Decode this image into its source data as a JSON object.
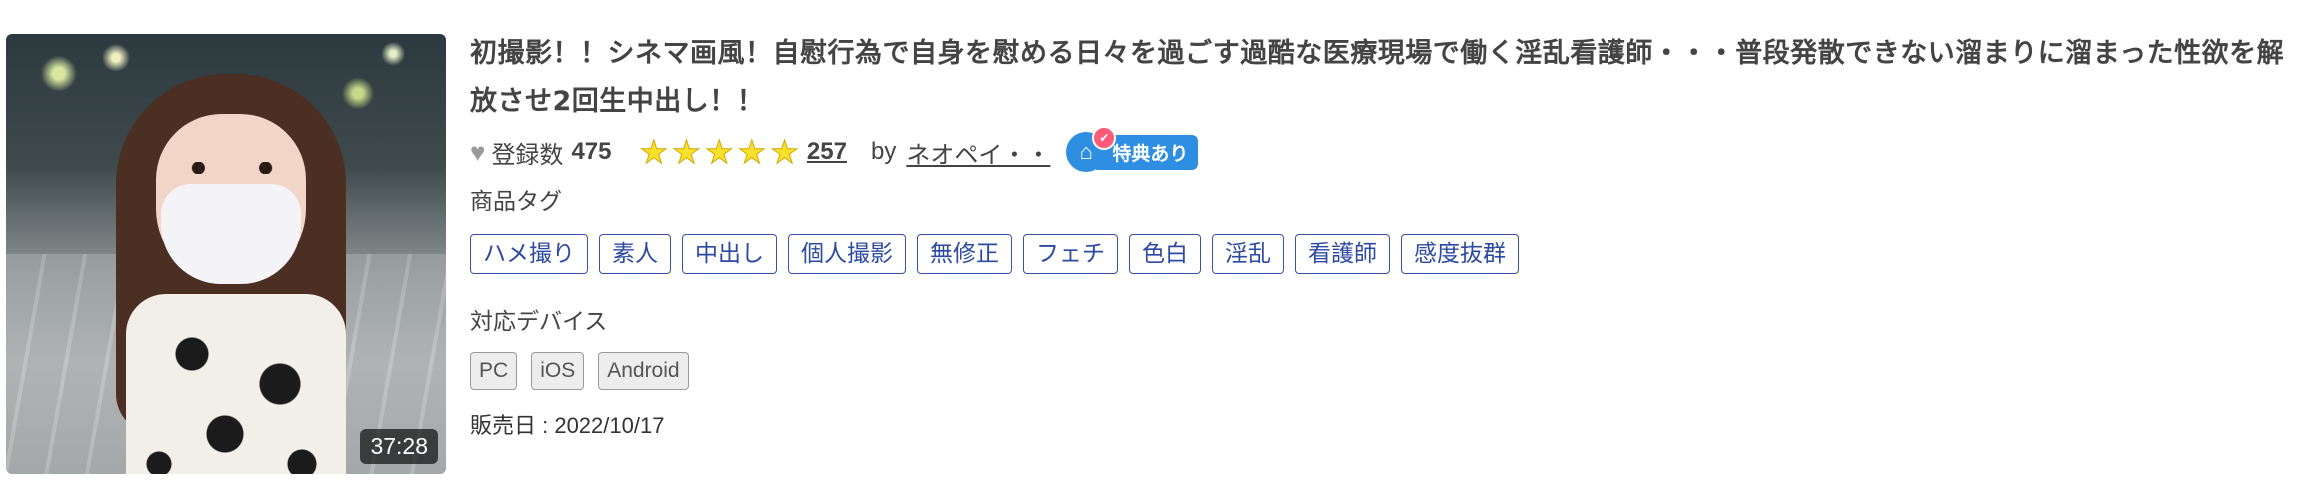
{
  "thumbnail": {
    "duration": "37:28"
  },
  "title": "初撮影！！シネマ画風！自慰行為で自身を慰める日々を過ごす過酷な医療現場で働く淫乱看護師・・・普段発散できない溜まりに溜まった性欲を解放させ2回生中出し！！",
  "meta": {
    "heart_icon": "heart-icon",
    "registered_label": "登録数",
    "registered_count": "475",
    "rating_stars": 5,
    "review_count": "257",
    "by_label": "by",
    "author": "ネオペイ・・",
    "perk_label": "特典あり"
  },
  "tags_title": "商品タグ",
  "tags": [
    "ハメ撮り",
    "素人",
    "中出し",
    "個人撮影",
    "無修正",
    "フェチ",
    "色白",
    "淫乱",
    "看護師",
    "感度抜群"
  ],
  "devices_title": "対応デバイス",
  "devices": [
    "PC",
    "iOS",
    "Android"
  ],
  "release": "販売日 : 2022/10/17",
  "colors": {
    "tag_border": "#3552a8",
    "star": "#f7e12b",
    "perk": "#2e8fe2"
  }
}
